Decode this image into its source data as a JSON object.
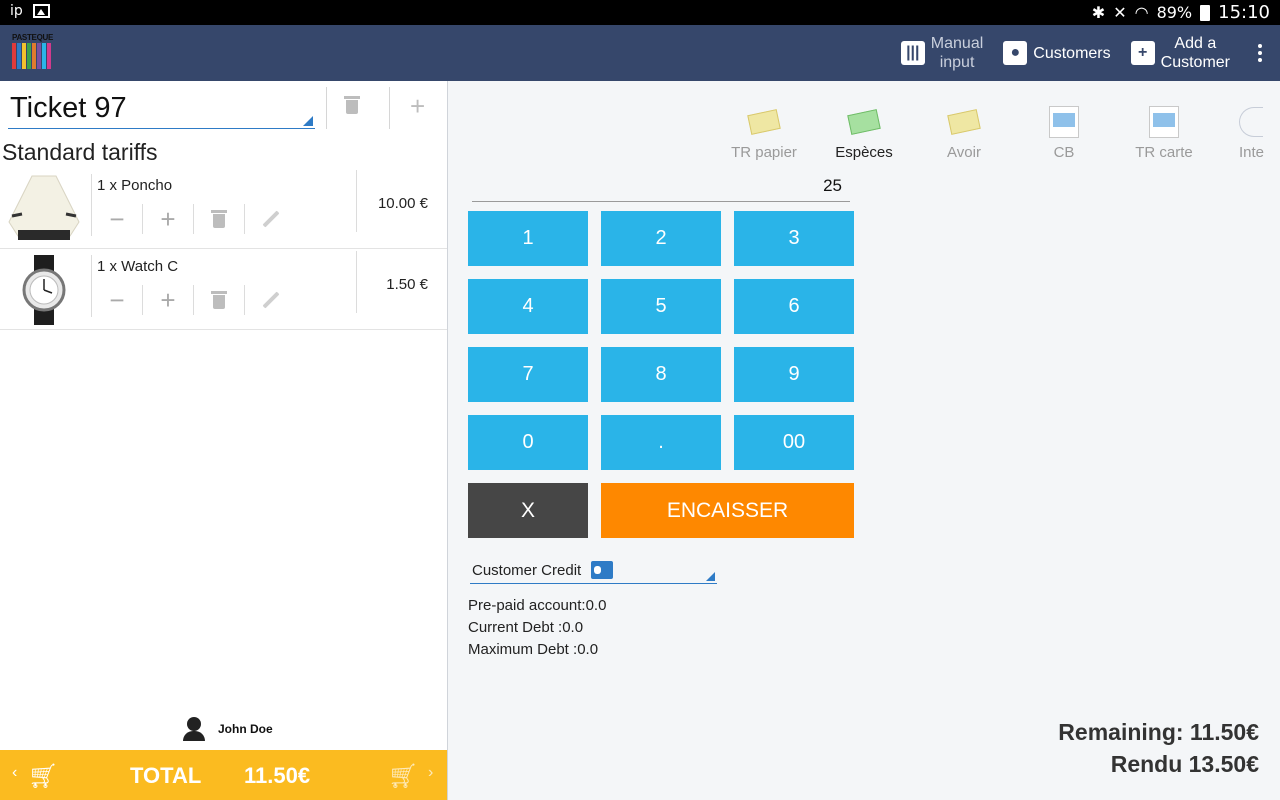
{
  "status_bar": {
    "carrier": "ip",
    "battery": "89%",
    "time": "15:10"
  },
  "app_bar": {
    "logo_text": "PASTEQUE",
    "manual_input": "Manual\ninput",
    "customers": "Customers",
    "add_customer": "Add a\nCustomer"
  },
  "ticket": {
    "title": "Ticket 97",
    "tariff": "Standard tariffs",
    "lines": [
      {
        "desc": "1 x Poncho",
        "price": "10.00 €",
        "image": "poncho"
      },
      {
        "desc": "1 x Watch C",
        "price": "1.50 €",
        "image": "watch"
      }
    ],
    "customer": "John Doe",
    "total_label": "TOTAL",
    "total_amount": "11.50€"
  },
  "payment_types": [
    {
      "label": "TR papier",
      "icon": "paper-voucher-icon",
      "selected": false
    },
    {
      "label": "Espèces",
      "icon": "cash-icon",
      "selected": true
    },
    {
      "label": "Avoir",
      "icon": "credit-note-icon",
      "selected": false
    },
    {
      "label": "CB",
      "icon": "card-icon",
      "selected": false
    },
    {
      "label": "TR carte",
      "icon": "voucher-card-icon",
      "selected": false
    },
    {
      "label": "Inte",
      "icon": "internet-icon",
      "selected": false
    }
  ],
  "amount_input": "25",
  "keypad": [
    "1",
    "2",
    "3",
    "4",
    "5",
    "6",
    "7",
    "8",
    "9",
    "0",
    ".",
    "00"
  ],
  "clear_label": "X",
  "pay_label": "ENCAISSER",
  "credit": {
    "select": "Customer Credit",
    "prepaid": "Pre-paid account:0.0",
    "current_debt": "Current Debt :0.0",
    "max_debt": "Maximum Debt :0.0"
  },
  "remaining": "Remaining: 11.50€",
  "change": "Rendu 13.50€",
  "colors": {
    "appbar": "#36476b",
    "key": "#2ab4e8",
    "pay": "#fe8800",
    "total_bar": "#fbbb20",
    "clear": "#464646"
  }
}
